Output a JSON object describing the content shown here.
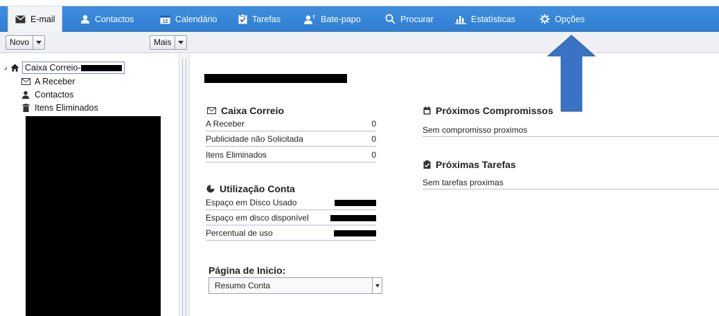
{
  "nav": {
    "tabs": [
      {
        "label": "E-mail",
        "icon": "envelope-icon",
        "active": true
      },
      {
        "label": "Contactos",
        "icon": "person-icon"
      },
      {
        "label": "Calendário",
        "icon": "calendar-icon"
      },
      {
        "label": "Tarefas",
        "icon": "checklist-icon"
      },
      {
        "label": "Bate-papo",
        "icon": "chat-person-icon"
      },
      {
        "label": "Procurar",
        "icon": "search-icon"
      },
      {
        "label": "Estatísticas",
        "icon": "bar-chart-icon"
      },
      {
        "label": "Opções",
        "icon": "gear-icon"
      }
    ]
  },
  "toolbar": {
    "new_label": "Novo",
    "more_label": "Mais"
  },
  "tree": {
    "root_label": "Caixa Correio-",
    "items": [
      {
        "label": "A Receber",
        "icon": "envelope-icon"
      },
      {
        "label": "Contactos",
        "icon": "person-icon"
      },
      {
        "label": "Itens Eliminados",
        "icon": "trash-icon"
      }
    ]
  },
  "mailbox": {
    "title": "Caixa Correio",
    "rows": [
      {
        "label": "A Receber",
        "value": "0"
      },
      {
        "label": "Publicidade não Solicitada",
        "value": "0"
      },
      {
        "label": "Itens Eliminados",
        "value": "0"
      }
    ]
  },
  "usage": {
    "title": "Utilização Conta",
    "rows": [
      {
        "label": "Espaço em Disco Usado"
      },
      {
        "label": "Espaço em disco disponível"
      },
      {
        "label": "Percentual de uso"
      }
    ]
  },
  "homepage": {
    "title": "Página de Inicio:",
    "selected": "Resumo Conta"
  },
  "appointments": {
    "title": "Próximos Compromissos",
    "empty_text": "Sem compromisso proximos"
  },
  "tasks": {
    "title": "Próximas Tarefas",
    "empty_text": "Sem tarefas proximas"
  },
  "colors": {
    "nav_bg": "#3586d9",
    "annotation_arrow": "#3a72c4",
    "redaction": "#000000"
  }
}
